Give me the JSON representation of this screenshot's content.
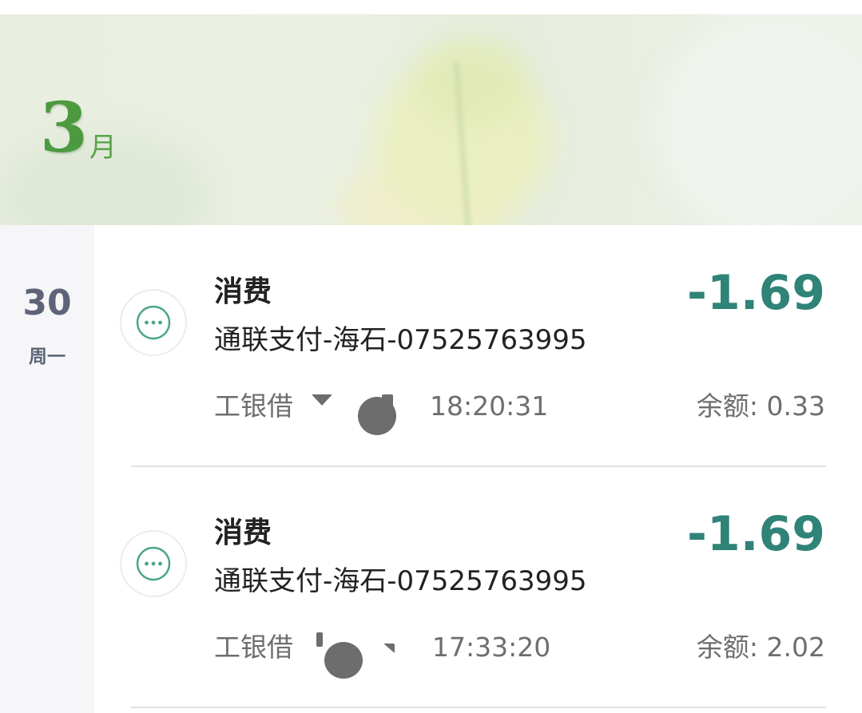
{
  "header": {
    "month_number": "3",
    "month_unit": "月"
  },
  "day": {
    "date": "30",
    "weekday": "周一"
  },
  "transactions": [
    {
      "type": "消费",
      "description": "通联支付-海石-07525763995",
      "amount": "-1.69",
      "account_visible": "工银借",
      "time": "18:20:31",
      "balance_label": "余额: 0.33",
      "icon": "more-dots-icon"
    },
    {
      "type": "消费",
      "description": "通联支付-海石-07525763995",
      "amount": "-1.69",
      "account_visible": "工银借",
      "time": "17:33:20",
      "balance_label": "余额: 2.02",
      "icon": "more-dots-icon"
    }
  ],
  "colors": {
    "amount": "#2f8377",
    "month": "#4c9a40",
    "icon": "#4aa58c",
    "day": "#5e6478"
  }
}
